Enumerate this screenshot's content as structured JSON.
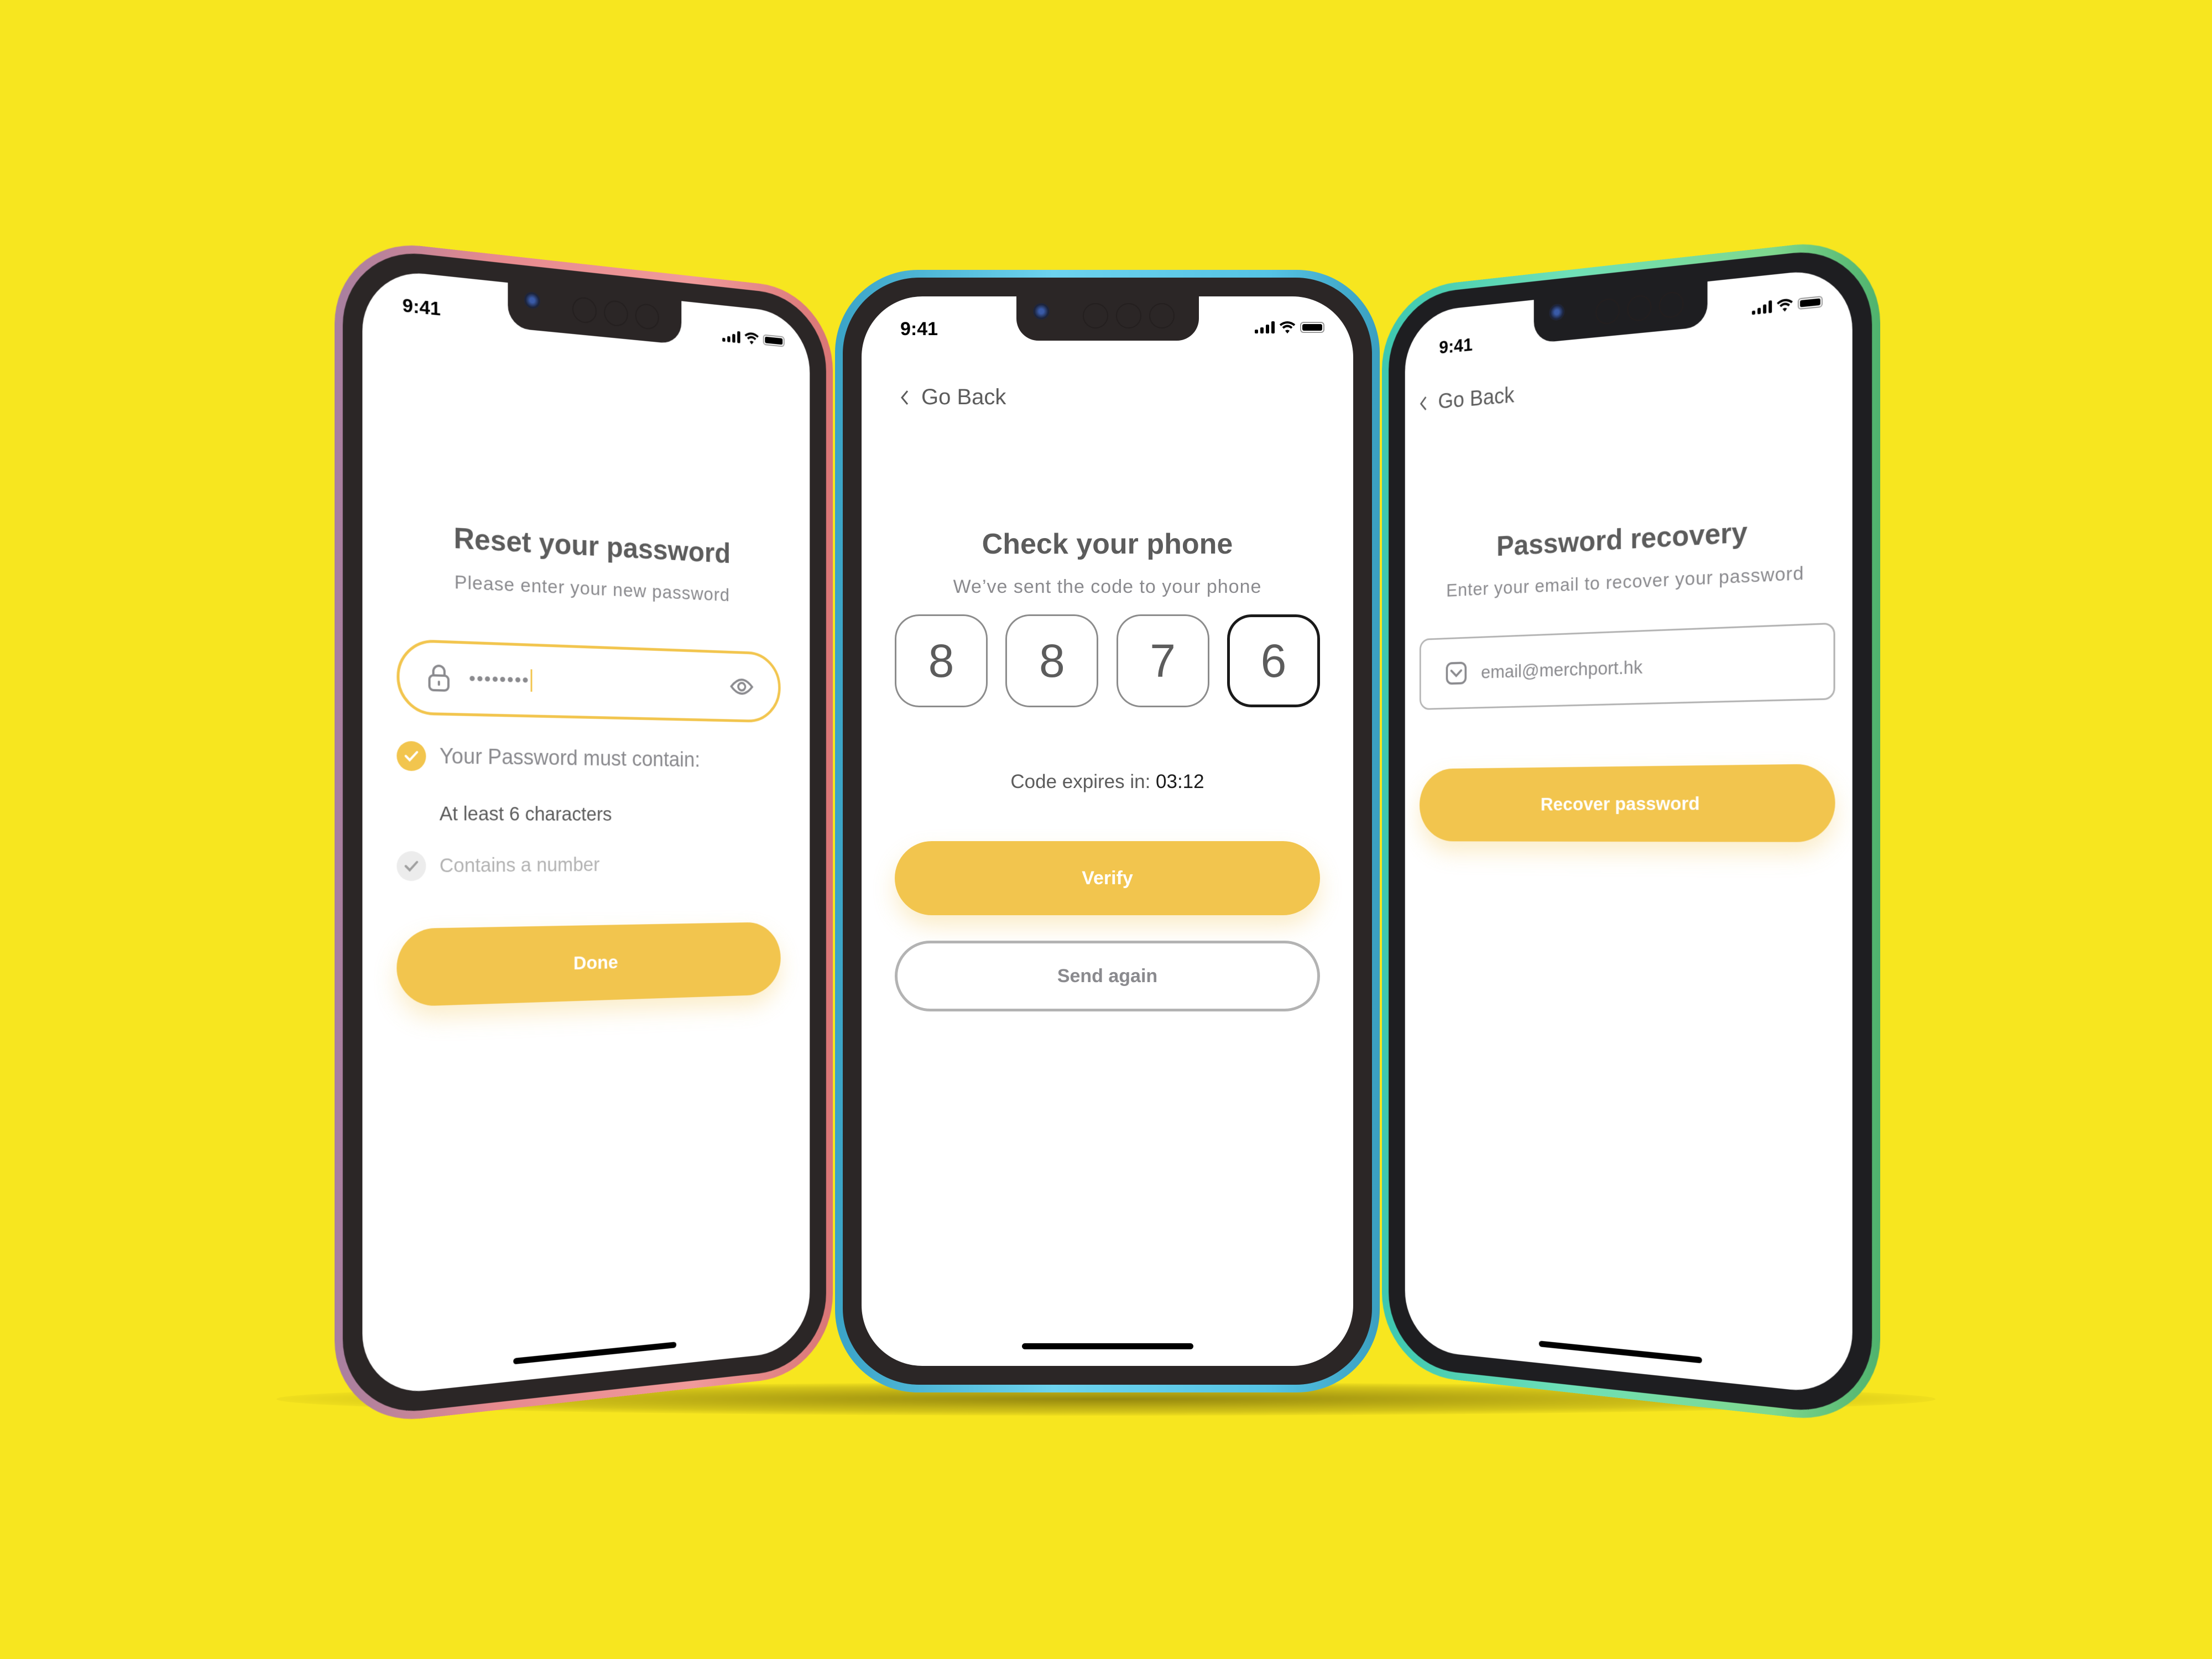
{
  "status": {
    "time": "9:41"
  },
  "colors": {
    "background": "#f7e61f",
    "accent": "#f2c54e",
    "text_dark": "#5c5c5c",
    "text_muted": "#8a8a8e"
  },
  "reset_screen": {
    "title": "Reset your password",
    "subtitle": "Please enter your new password",
    "password_value": "••••••••",
    "requirements_heading": "Your Password must contain:",
    "requirements": [
      {
        "label": "At least 6 characters",
        "met": true
      },
      {
        "label": "Contains a number",
        "met": false
      }
    ],
    "done_label": "Done",
    "icons": {
      "lock": "lock-icon",
      "eye": "eye-icon",
      "check": "check-icon"
    }
  },
  "verify_screen": {
    "back_label": "Go Back",
    "title": "Check your phone",
    "subtitle": "We’ve sent the code to your phone",
    "code_digits": [
      "8",
      "8",
      "7",
      "6"
    ],
    "expires_label": "Code expires in: ",
    "expires_value": "03:12",
    "verify_label": "Verify",
    "send_again_label": "Send again"
  },
  "recovery_screen": {
    "back_label": "Go Back",
    "title": "Password recovery",
    "subtitle": "Enter your email to recover your password",
    "email_value": "email@merchport.hk",
    "recover_label": "Recover password"
  }
}
